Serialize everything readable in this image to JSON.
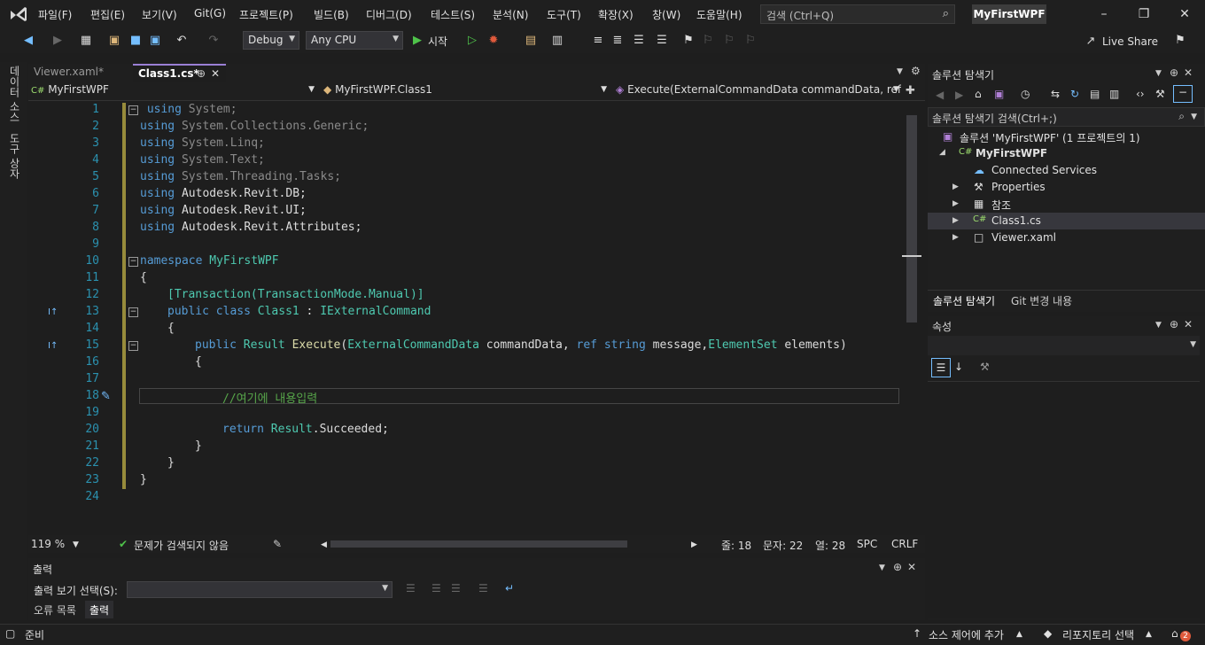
{
  "titlebar": {
    "menu": [
      "파일(F)",
      "편집(E)",
      "보기(V)",
      "Git(G)",
      "프로젝트(P)",
      "빌드(B)",
      "디버그(D)",
      "테스트(S)",
      "분석(N)",
      "도구(T)",
      "확장(X)",
      "창(W)",
      "도움말(H)"
    ],
    "search_placeholder": "검색 (Ctrl+Q)",
    "project_name": "MyFirstWPF"
  },
  "toolbar": {
    "config": "Debug",
    "platform": "Any CPU",
    "start_label": "시작",
    "live_share": "Live Share"
  },
  "left_strip": {
    "items": [
      "데이터 소스",
      "도구 상자"
    ]
  },
  "editor": {
    "tabs": [
      {
        "label": "Viewer.xaml*"
      },
      {
        "label": "Class1.cs*",
        "active": true
      }
    ],
    "nav": {
      "project": "MyFirstWPF",
      "class": "MyFirstWPF.Class1",
      "member": "Execute(ExternalCommandData commandData, ref str"
    },
    "lines": [
      {
        "n": "1",
        "t": "using System;"
      },
      {
        "n": "2",
        "t": "using System.Collections.Generic;"
      },
      {
        "n": "3",
        "t": "using System.Linq;"
      },
      {
        "n": "4",
        "t": "using System.Text;"
      },
      {
        "n": "5",
        "t": "using System.Threading.Tasks;"
      },
      {
        "n": "6",
        "t": "using Autodesk.Revit.DB;"
      },
      {
        "n": "7",
        "t": "using Autodesk.Revit.UI;"
      },
      {
        "n": "8",
        "t": "using Autodesk.Revit.Attributes;"
      },
      {
        "n": "9",
        "t": ""
      },
      {
        "n": "10",
        "t": "namespace MyFirstWPF"
      },
      {
        "n": "11",
        "t": "{"
      },
      {
        "n": "12",
        "t": "[Transaction(TransactionMode.Manual)]"
      },
      {
        "n": "13",
        "t": "public class Class1 : IExternalCommand"
      },
      {
        "n": "14",
        "t": "{"
      },
      {
        "n": "15",
        "t": "public Result Execute(ExternalCommandData commandData, ref string message,ElementSet elements)"
      },
      {
        "n": "16",
        "t": "{"
      },
      {
        "n": "17",
        "t": ""
      },
      {
        "n": "18",
        "t": "//여기에 내용입력"
      },
      {
        "n": "19",
        "t": ""
      },
      {
        "n": "20",
        "t": "return Result.Succeeded;"
      },
      {
        "n": "21",
        "t": "}"
      },
      {
        "n": "22",
        "t": "}"
      },
      {
        "n": "23",
        "t": "}"
      },
      {
        "n": "24",
        "t": ""
      }
    ],
    "status": {
      "zoom": "119 %",
      "issues": "문제가 검색되지 않음",
      "line": "줄: 18",
      "char": "문자: 22",
      "col": "열: 28",
      "spc": "SPC",
      "eol": "CRLF"
    }
  },
  "output": {
    "title": "출력",
    "show_label": "출력 보기 선택(S):",
    "tabs": [
      "오류 목록",
      "출력"
    ]
  },
  "solution_explorer": {
    "title": "솔루션 탐색기",
    "search_placeholder": "솔루션 탐색기 검색(Ctrl+;)",
    "solution": "솔루션 'MyFirstWPF' (1 프로젝트의 1)",
    "project": "MyFirstWPF",
    "items": [
      "Connected Services",
      "Properties",
      "참조",
      "Class1.cs",
      "Viewer.xaml"
    ],
    "tabs": [
      "솔루션 탐색기",
      "Git 변경 내용"
    ]
  },
  "properties": {
    "title": "속성"
  },
  "statusbar": {
    "ready": "준비",
    "source_control": "소스 제어에 추가",
    "repository": "리포지토리 선택",
    "notifications": "2"
  },
  "colors": {
    "accent": "#9a7fd4",
    "keyword": "#569cd6",
    "type": "#4ec9b0",
    "comment": "#57a64a"
  }
}
